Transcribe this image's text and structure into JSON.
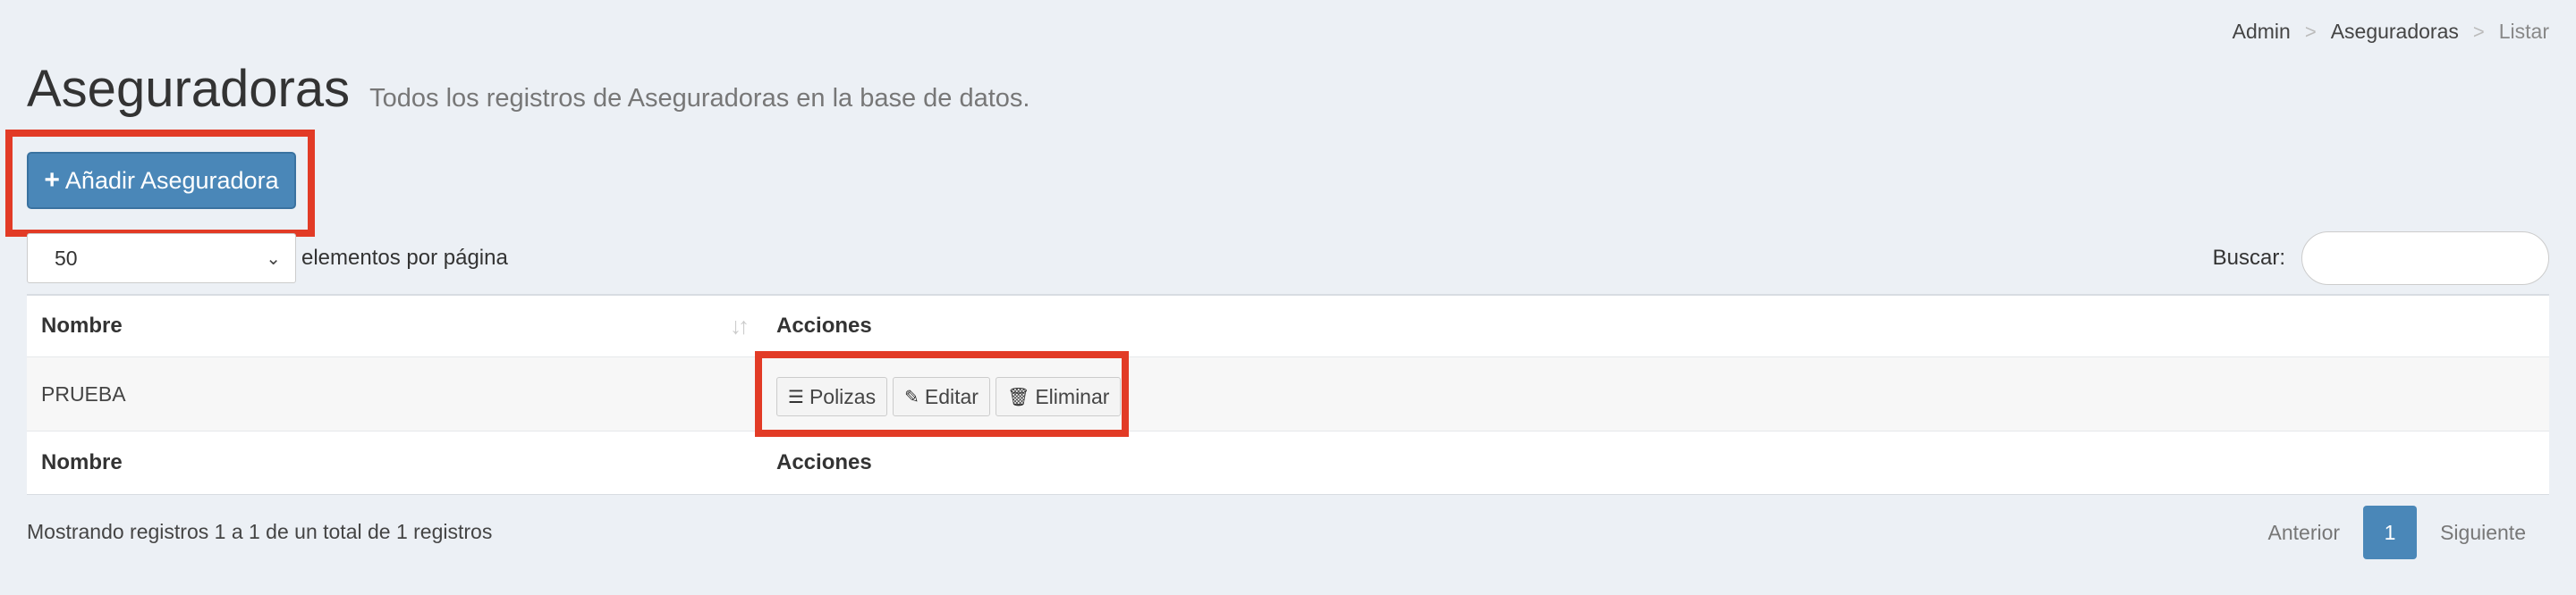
{
  "breadcrumb": {
    "items": [
      "Admin",
      "Aseguradoras",
      "Listar"
    ],
    "separator": ">"
  },
  "header": {
    "title": "Aseguradoras",
    "subtitle": "Todos los registros de Aseguradoras en la base de datos."
  },
  "toolbar": {
    "add_icon": "+",
    "add_label": "Añadir Aseguradora"
  },
  "length": {
    "selected": "50",
    "label": "elementos por página"
  },
  "search": {
    "label": "Buscar:",
    "value": "",
    "placeholder": ""
  },
  "table": {
    "columns": [
      "Nombre",
      "Acciones"
    ],
    "rows": [
      {
        "name": "PRUEBA"
      }
    ],
    "actions": {
      "polizas": {
        "icon": "list-icon",
        "label": "Polizas"
      },
      "editar": {
        "icon": "edit-icon",
        "label": "Editar"
      },
      "eliminar": {
        "icon": "trash-icon",
        "label": "Eliminar"
      }
    },
    "footer_columns": [
      "Nombre",
      "Acciones"
    ]
  },
  "info": "Mostrando registros 1 a 1 de un total de 1 registros",
  "pagination": {
    "previous": "Anterior",
    "current": "1",
    "next": "Siguiente"
  },
  "colors": {
    "primary": "#4a87b8",
    "annotation": "#e23b26",
    "background": "#ecf0f5"
  }
}
